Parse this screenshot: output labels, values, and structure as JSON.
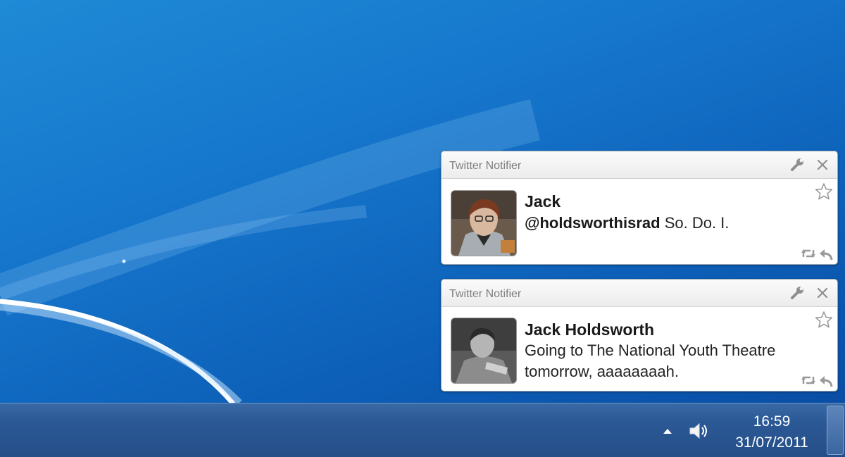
{
  "colors": {
    "desktop": "#1677cc",
    "taskbar": "#2c5a96",
    "notif_bg": "#ffffff",
    "header_text": "#7d7d7d"
  },
  "notifications": [
    {
      "app_title": "Twitter Notifier",
      "author": "Jack",
      "mention": "@holdsworthisrad",
      "message": " So. Do. I.",
      "avatar": "avatar-photo",
      "icons": [
        "wrench-icon",
        "close-icon",
        "star-icon",
        "retweet-icon",
        "reply-icon"
      ]
    },
    {
      "app_title": "Twitter Notifier",
      "author": "Jack Holdsworth",
      "mention": "",
      "message": "Going to The National Youth Theatre tomorrow, aaaaaaaah.",
      "avatar": "avatar-photo",
      "icons": [
        "wrench-icon",
        "close-icon",
        "star-icon",
        "retweet-icon",
        "reply-icon"
      ]
    }
  ],
  "taskbar": {
    "time": "16:59",
    "date": "31/07/2011",
    "tray_icons": [
      "show-hidden-icons-arrow",
      "volume-icon"
    ]
  }
}
